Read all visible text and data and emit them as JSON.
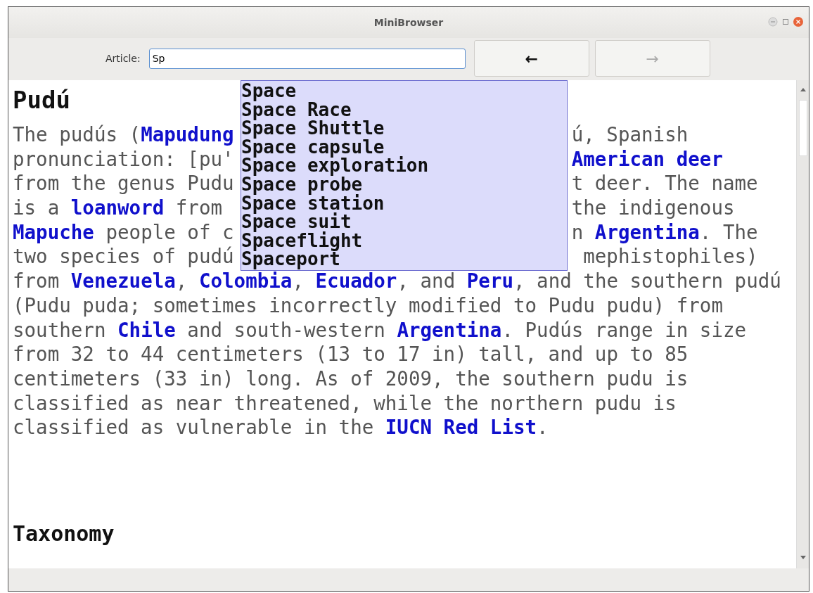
{
  "window": {
    "title": "MiniBrowser"
  },
  "toolbar": {
    "label": "Article:",
    "field": {
      "value": "Sp"
    },
    "buttons": [
      {
        "text": "←",
        "disabled": false
      },
      {
        "text": "→",
        "disabled": true
      }
    ]
  },
  "article": {
    "title": "Pudú",
    "lines": [
      {
        "left": [
          {
            "text": "The pudús ("
          },
          {
            "text": "Mapudung",
            "link": true
          }
        ],
        "right": [
          {
            "text": "ú, Spanish"
          }
        ]
      },
      {
        "left": [
          {
            "text": "pronunciation: [pu'"
          }
        ],
        "right": [
          {
            "text": " American deer",
            "link": true
          }
        ]
      },
      {
        "left": [
          {
            "text": "from the genus Pudu"
          }
        ],
        "right": [
          {
            "text": "t deer. The name"
          }
        ]
      },
      {
        "left": [
          {
            "text": "is a "
          },
          {
            "text": "loanword",
            "link": true
          },
          {
            "text": " from"
          }
        ],
        "right": [
          {
            "text": "the indigenous"
          }
        ]
      },
      {
        "left": [
          {
            "text": "Mapuche",
            "link": true
          },
          {
            "text": " people of c"
          }
        ],
        "right": [
          {
            "text": "n "
          },
          {
            "text": "Argentina",
            "link": true
          },
          {
            "text": ". The"
          }
        ]
      },
      {
        "left": [
          {
            "text": "two species of pudú"
          }
        ],
        "right": [
          {
            "text": " mephistophiles)"
          }
        ]
      },
      {
        "left": [
          {
            "text": "from "
          },
          {
            "text": "Venezuela",
            "link": true
          },
          {
            "text": ", "
          },
          {
            "text": "Colombia",
            "link": true
          },
          {
            "text": ", "
          },
          {
            "text": "Ecuador",
            "link": true
          },
          {
            "text": ", and "
          },
          {
            "text": "Peru",
            "link": true
          },
          {
            "text": ", and the southern pudú"
          }
        ]
      },
      {
        "left": [
          {
            "text": "(Pudu puda; sometimes incorrectly modified to Pudu pudu) from"
          }
        ]
      },
      {
        "left": [
          {
            "text": "southern "
          },
          {
            "text": "Chile",
            "link": true
          },
          {
            "text": " and south-western "
          },
          {
            "text": "Argentina",
            "link": true
          },
          {
            "text": ". Pudús range in size"
          }
        ]
      },
      {
        "left": [
          {
            "text": "from 32 to 44 centimeters (13 to 17 in) tall, and up to 85"
          }
        ]
      },
      {
        "left": [
          {
            "text": "centimeters (33 in) long. As of 2009, the southern pudu is"
          }
        ]
      },
      {
        "left": [
          {
            "text": "classified as near threatened, while the northern pudu is"
          }
        ]
      },
      {
        "left": [
          {
            "text": "classified as vulnerable in the "
          },
          {
            "text": "IUCN Red List",
            "link": true
          },
          {
            "text": "."
          }
        ]
      }
    ],
    "section": {
      "title": "Taxonomy"
    }
  },
  "suggestions": [
    "Space",
    "Space Race",
    "Space Shuttle",
    "Space capsule",
    "Space exploration",
    "Space probe",
    "Space station",
    "Space suit",
    "Spaceflight",
    "Spaceport"
  ]
}
